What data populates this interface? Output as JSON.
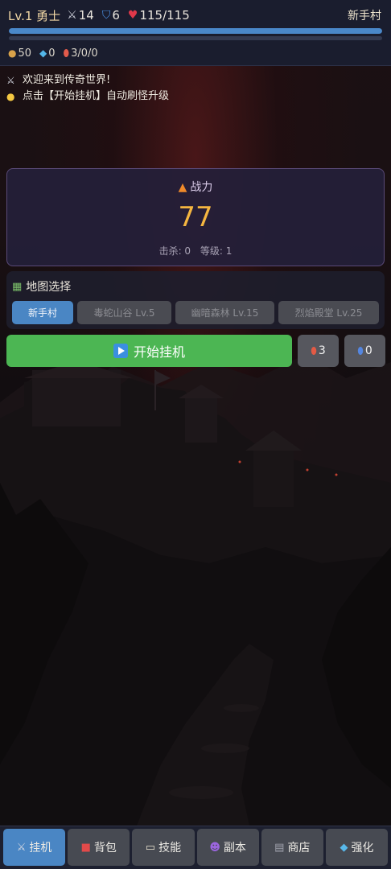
{
  "header": {
    "level": "Lv.1",
    "title": "勇士",
    "attack": "14",
    "defense": "6",
    "hp": "115/115",
    "location": "新手村",
    "hp_fraction": 1.0,
    "exp_fraction": 0.0,
    "gold": "50",
    "gems": "0",
    "potions": "3/0/0"
  },
  "log": [
    {
      "icon": "crossed-swords-icon",
      "text": "欢迎来到传奇世界!"
    },
    {
      "icon": "lightbulb-icon",
      "text": "点击【开始挂机】自动刷怪升级"
    }
  ],
  "power": {
    "title": "战力",
    "value": "77",
    "kills_label": "击杀: 0",
    "level_label": "等级: 1"
  },
  "map": {
    "title": "地图选择",
    "tabs": [
      {
        "label": "新手村",
        "active": true
      },
      {
        "label": "毒蛇山谷 Lv.5",
        "active": false
      },
      {
        "label": "幽暗森林 Lv.15",
        "active": false
      },
      {
        "label": "烈焰殿堂 Lv.25",
        "active": false
      }
    ]
  },
  "actions": {
    "start_label": "开始挂机",
    "hp_potion_count": "3",
    "mp_potion_count": "0"
  },
  "nav": [
    {
      "icon": "crossed-swords-icon",
      "label": "挂机",
      "active": true
    },
    {
      "icon": "bag-icon",
      "label": "背包",
      "active": false
    },
    {
      "icon": "book-icon",
      "label": "技能",
      "active": false
    },
    {
      "icon": "devil-icon",
      "label": "副本",
      "active": false
    },
    {
      "icon": "shop-cart-icon",
      "label": "商店",
      "active": false
    },
    {
      "icon": "gem-icon",
      "label": "强化",
      "active": false
    }
  ],
  "colors": {
    "accent_blue": "#4a86c4",
    "start_green": "#4cb653",
    "power_gold": "#f5b640",
    "header_bg": "#1a1d2e"
  }
}
